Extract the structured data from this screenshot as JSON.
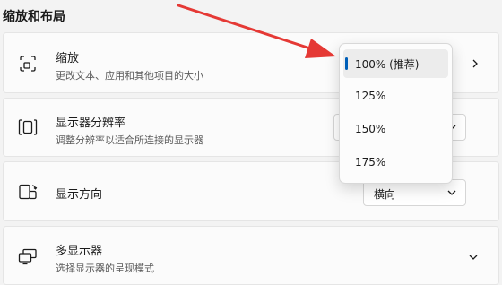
{
  "section": {
    "title": "缩放和布局"
  },
  "cards": [
    {
      "title": "缩放",
      "subtitle": "更改文本、应用和其他项目的大小",
      "icon": "scale-icon"
    },
    {
      "title": "显示器分辨率",
      "subtitle": "调整分辨率以适合所连接的显示器",
      "icon": "resolution-icon"
    },
    {
      "title": "显示方向",
      "subtitle": "",
      "icon": "orientation-icon",
      "value": "横向"
    },
    {
      "title": "多显示器",
      "subtitle": "选择显示器的呈现模式",
      "icon": "multi-display-icon"
    }
  ],
  "scale_dropdown": {
    "options": [
      "100% (推荐)",
      "125%",
      "150%",
      "175%"
    ],
    "selected": "100% (推荐)"
  },
  "colors": {
    "accent": "#005fb8",
    "annotation_arrow": "#e53935"
  }
}
